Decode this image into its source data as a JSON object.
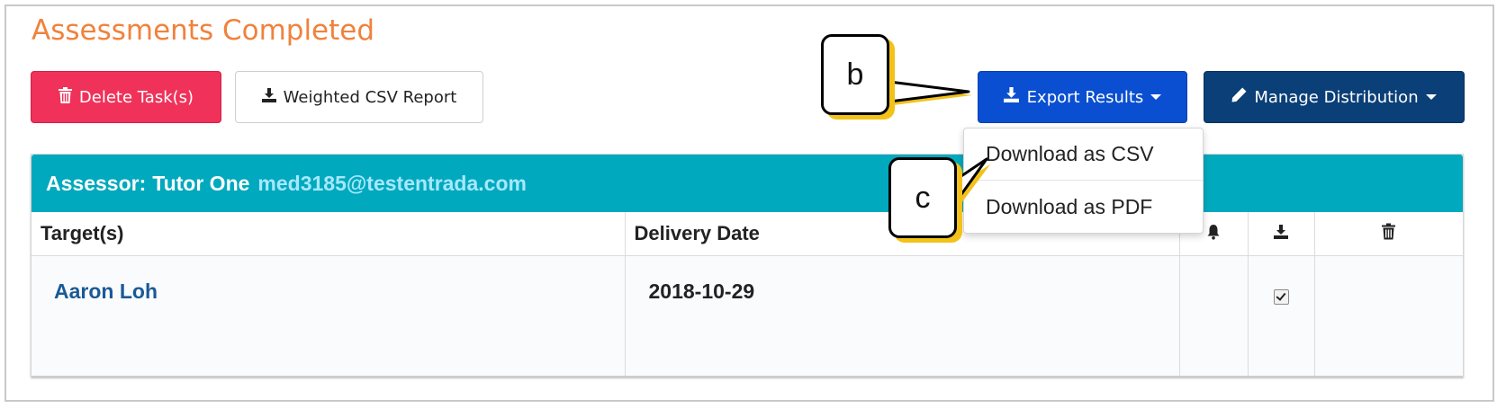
{
  "page": {
    "title": "Assessments Completed"
  },
  "toolbar": {
    "delete_label": "Delete Task(s)",
    "weighted_csv_label": "Weighted CSV Report",
    "export_label": "Export Results",
    "manage_label": "Manage Distribution"
  },
  "export_menu": {
    "items": [
      {
        "label": "Download as CSV"
      },
      {
        "label": "Download as PDF"
      }
    ]
  },
  "panel": {
    "assessor_label": "Assessor:",
    "assessor_name": "Tutor One",
    "assessor_email": "med3185@testentrada.com",
    "columns": {
      "targets": "Target(s)",
      "delivery_date": "Delivery Date",
      "notify_icon": "bell-icon",
      "download_icon": "download-icon",
      "delete_icon": "trash-icon"
    },
    "rows": [
      {
        "target": "Aaron Loh",
        "delivery_date": "2018-10-29",
        "download_checked": true
      }
    ]
  },
  "annotations": {
    "callout_b": "b",
    "callout_c": "c"
  },
  "colors": {
    "title": "#f0823c",
    "delete_button": "#f0325a",
    "export_button": "#0a4fd1",
    "manage_button": "#0a3f78",
    "panel_header": "#00a9bd",
    "assessor_email": "#a6e8ff",
    "target_link": "#1a5a96",
    "callout_shadow": "#f2c21a"
  }
}
